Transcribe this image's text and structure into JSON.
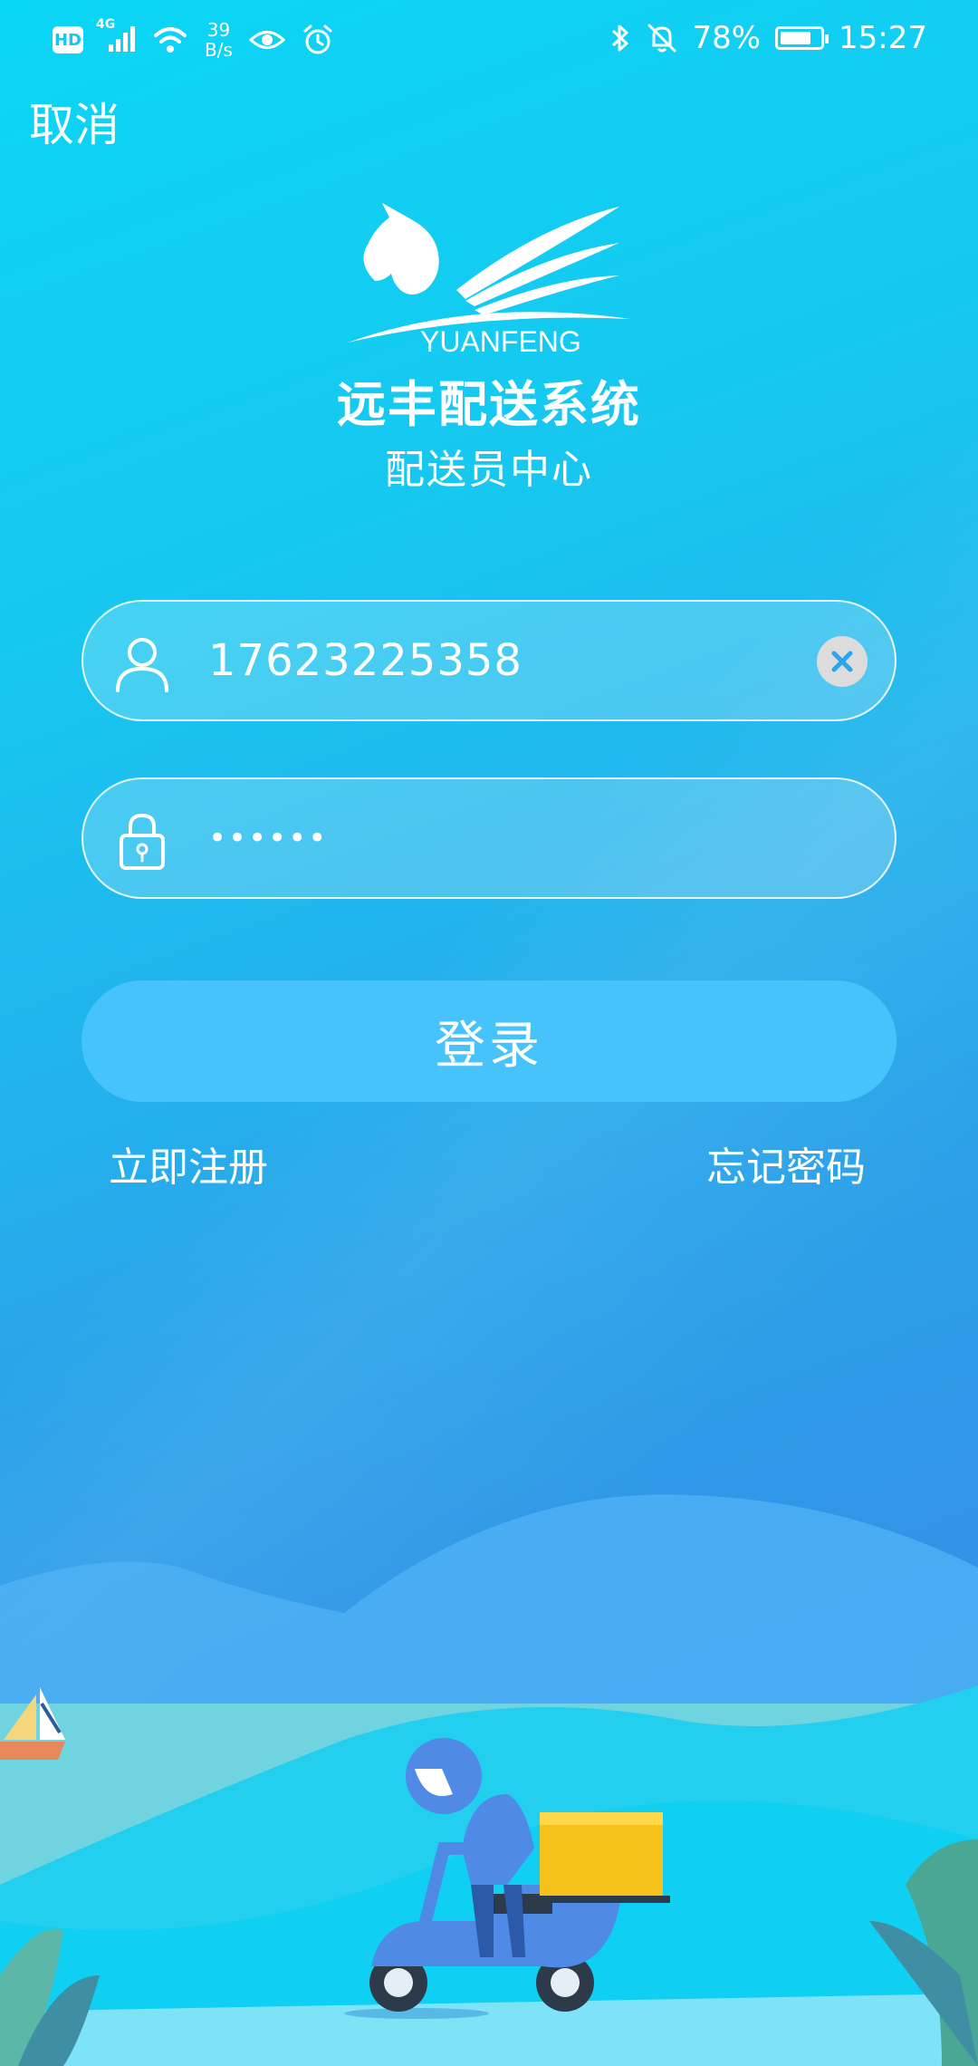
{
  "status_bar": {
    "hd": "HD",
    "network": "4G",
    "net_rate_value": "39",
    "net_rate_unit": "B/s",
    "battery_percent": "78%",
    "battery_level": 0.78,
    "time": "15:27"
  },
  "header": {
    "cancel_label": "取消"
  },
  "brand": {
    "logo_text": "YUANFENG",
    "title": "远丰配送系统",
    "subtitle": "配送员中心"
  },
  "login_form": {
    "username_value": "17623225358",
    "password_masked": "••••••"
  },
  "actions": {
    "login_label": "登录",
    "register_label": "立即注册",
    "forgot_label": "忘记密码"
  },
  "icons": {
    "user": "user-icon",
    "lock": "lock-icon",
    "clear": "clear-icon"
  },
  "colors": {
    "bg_top": "#0ad6f5",
    "bg_bottom": "#3b82e6",
    "login_button": "#47c3fb"
  }
}
